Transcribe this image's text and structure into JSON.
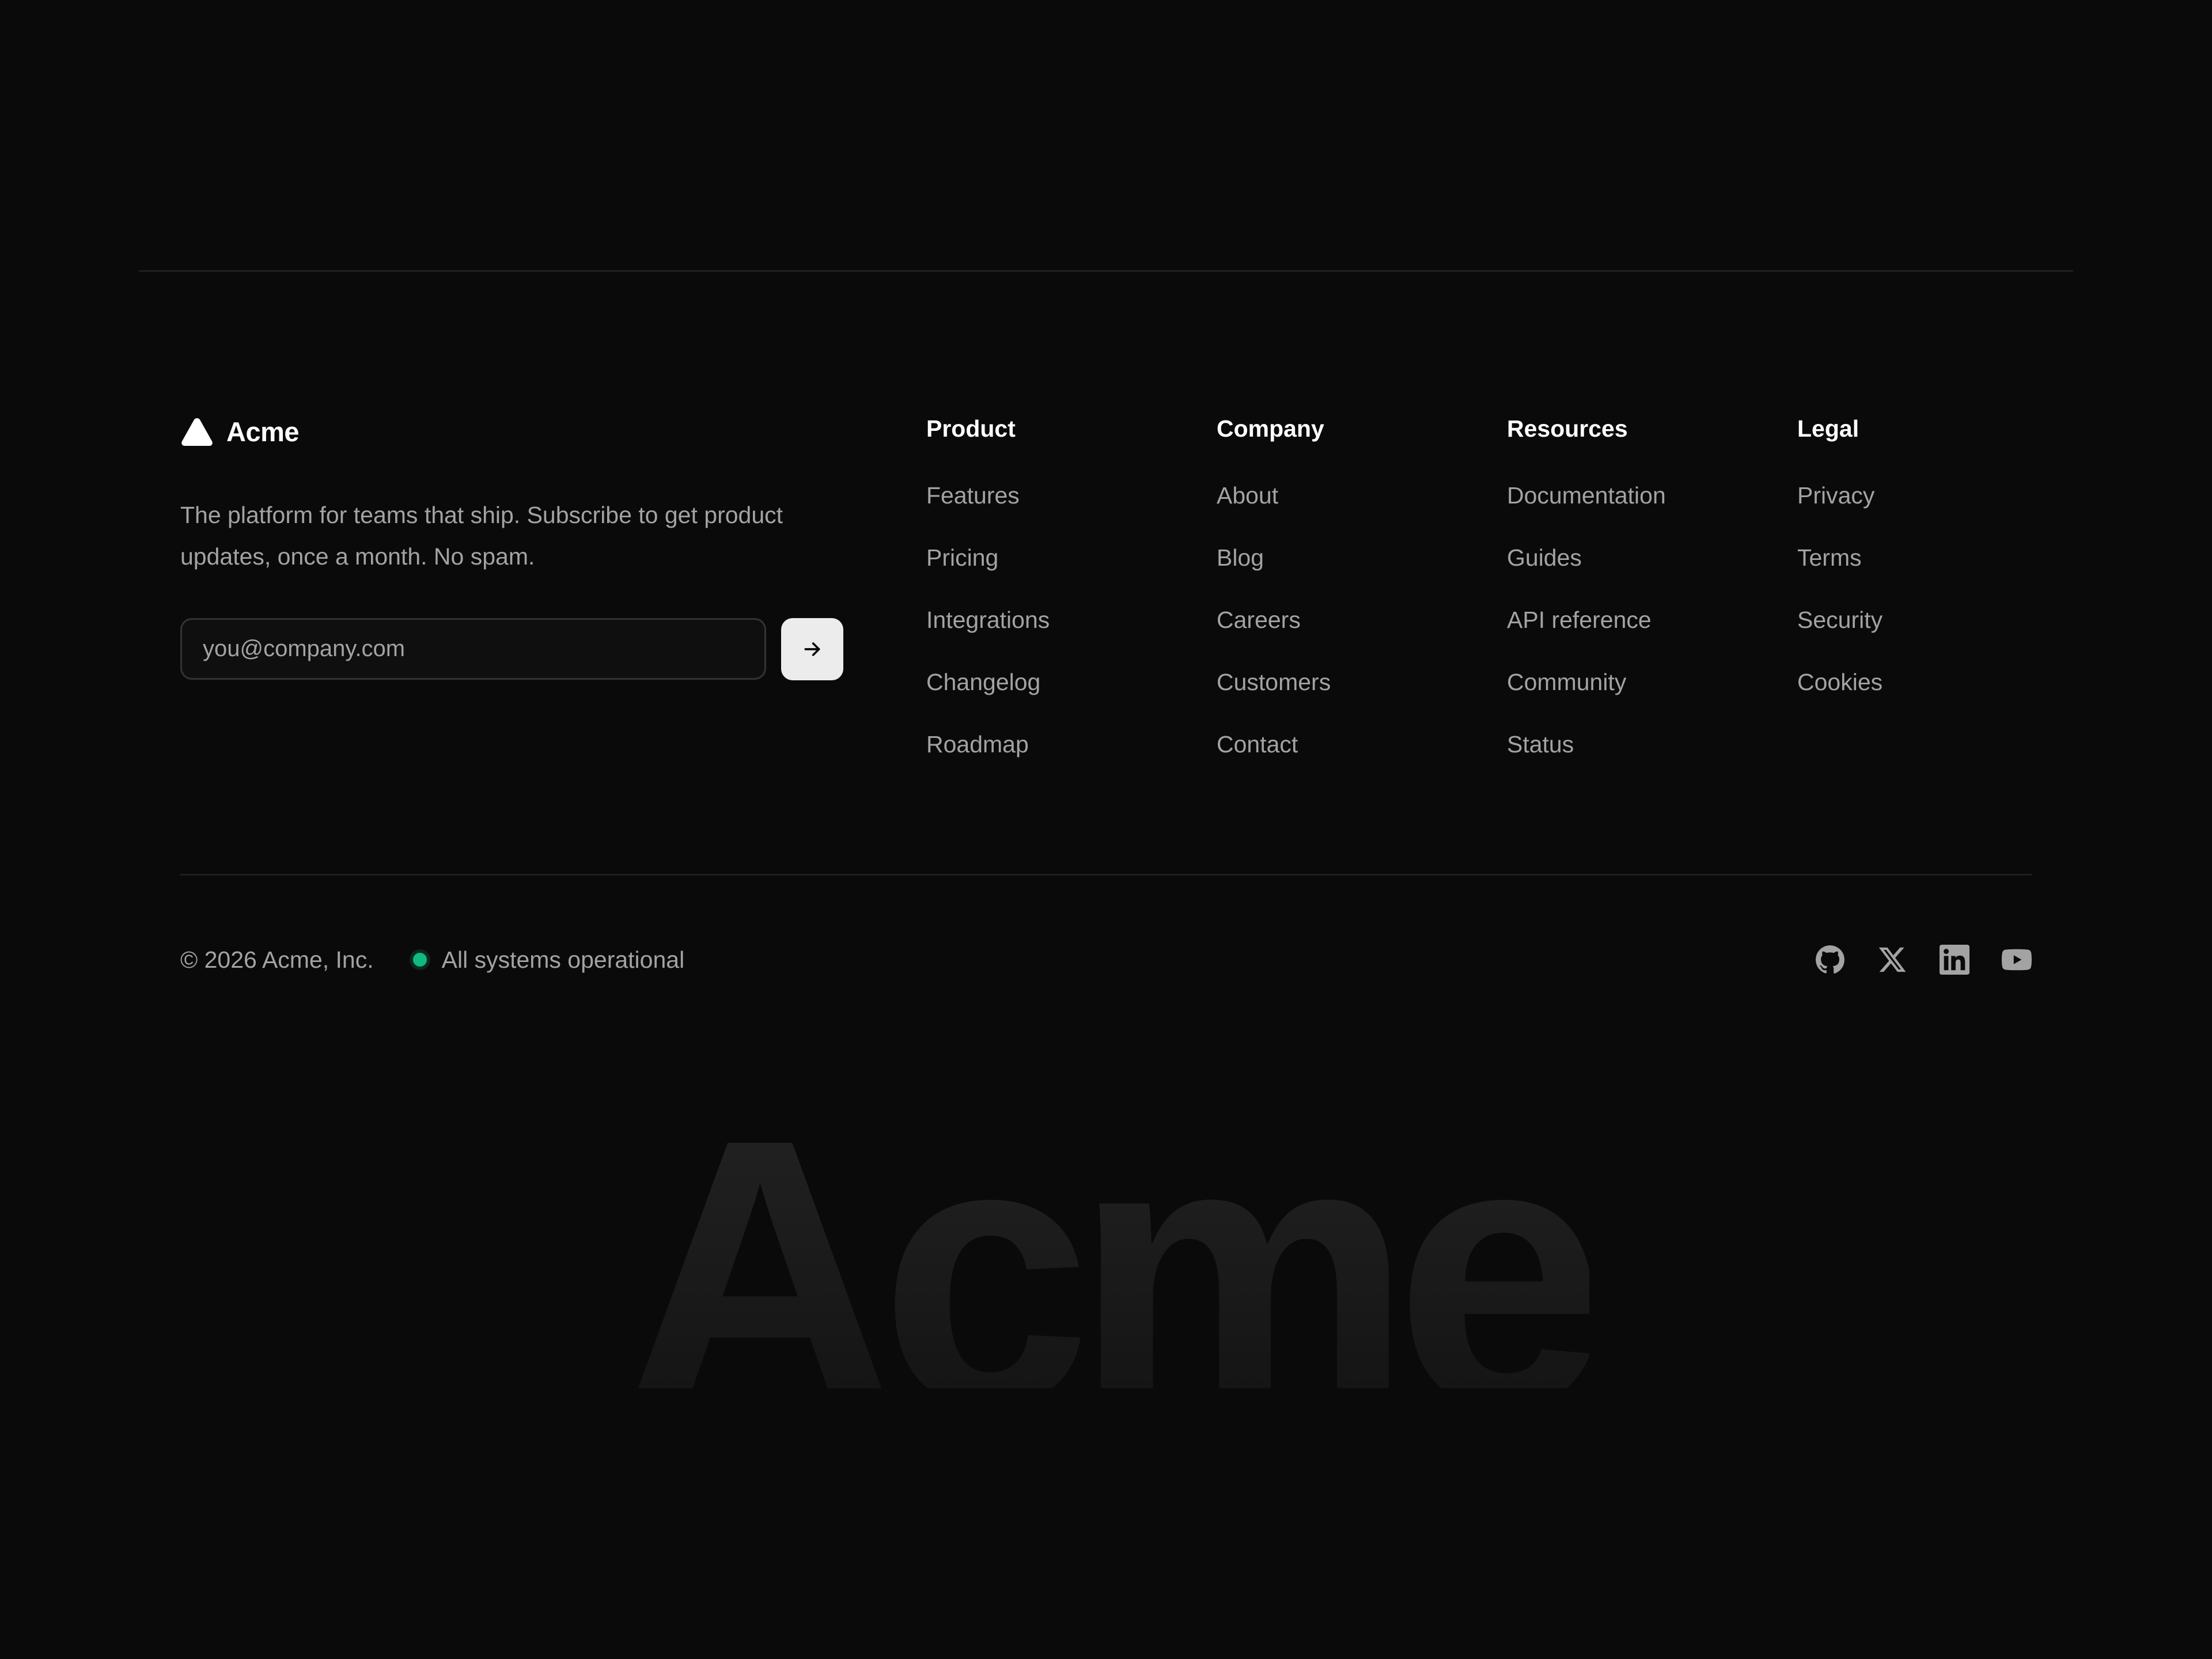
{
  "brand": {
    "name": "Acme",
    "logo_icon": "triangle-logo-icon",
    "tagline": "The platform for teams that ship. Subscribe to get product updates, once a month. No spam."
  },
  "newsletter": {
    "placeholder": "you@company.com",
    "value": "",
    "submit_icon": "arrow-right-icon"
  },
  "columns": [
    {
      "heading": "Product",
      "links": [
        "Features",
        "Pricing",
        "Integrations",
        "Changelog",
        "Roadmap"
      ]
    },
    {
      "heading": "Company",
      "links": [
        "About",
        "Blog",
        "Careers",
        "Customers",
        "Contact"
      ]
    },
    {
      "heading": "Resources",
      "links": [
        "Documentation",
        "Guides",
        "API reference",
        "Community",
        "Status"
      ]
    },
    {
      "heading": "Legal",
      "links": [
        "Privacy",
        "Terms",
        "Security",
        "Cookies"
      ]
    }
  ],
  "bottom": {
    "copyright": "© 2026 Acme, Inc.",
    "status_text": "All systems operational",
    "status_color": "#10b981"
  },
  "socials": [
    "github-icon",
    "x-icon",
    "linkedin-icon",
    "youtube-icon"
  ],
  "wordmark": "Acme",
  "colors": {
    "background": "#0a0a0a",
    "heading": "#ffffff",
    "muted_text": "#a3a3a3",
    "divider": "#1f1f1f",
    "button_bg": "#ececec"
  }
}
